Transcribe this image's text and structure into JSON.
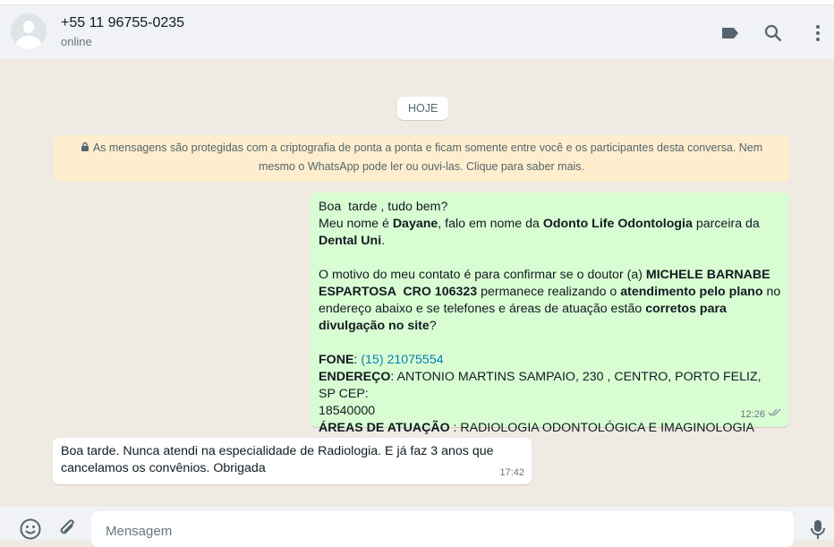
{
  "header": {
    "contact": "+55 11 96755-0235",
    "status": "online"
  },
  "chat": {
    "day_label": "HOJE",
    "encryption_notice": "As mensagens são protegidas com a criptografia de ponta a ponta e ficam somente entre você e os participantes desta conversa. Nem mesmo o WhatsApp pode ler ou ouvi-las. Clique para saber mais.",
    "messages": [
      {
        "direction": "out",
        "time": "12:26",
        "status": "read",
        "lines": [
          [
            {
              "t": "Boa  tarde , tudo bem?"
            }
          ],
          [
            {
              "t": "Meu nome é "
            },
            {
              "t": "Dayane",
              "b": true
            },
            {
              "t": ", falo em nome da "
            },
            {
              "t": "Odonto Life Odontologia",
              "b": true
            },
            {
              "t": " parceira da"
            }
          ],
          [
            {
              "t": "Dental Uni",
              "b": true
            },
            {
              "t": "."
            }
          ],
          [],
          [
            {
              "t": "O motivo do meu contato é para confirmar se o doutor (a) "
            },
            {
              "t": "MICHELE BARNABE",
              "b": true
            }
          ],
          [
            {
              "t": "ESPARTOSA  CRO 106323",
              "b": true
            },
            {
              "t": " permanece realizando o "
            },
            {
              "t": "atendimento pelo plano",
              "b": true
            },
            {
              "t": " no"
            }
          ],
          [
            {
              "t": "endereço abaixo e se telefones e áreas de atuação estão "
            },
            {
              "t": "corretos para",
              "b": true
            }
          ],
          [
            {
              "t": "divulgação no site",
              "b": true
            },
            {
              "t": "?"
            }
          ],
          [],
          [
            {
              "t": "FONE",
              "b": true
            },
            {
              "t": ": "
            },
            {
              "t": "(15) 21075554",
              "link": true
            }
          ],
          [
            {
              "t": "ENDEREÇO",
              "b": true
            },
            {
              "t": ": ANTONIO MARTINS SAMPAIO, 230 , CENTRO, PORTO FELIZ, SP CEP:"
            }
          ],
          [
            {
              "t": "18540000"
            }
          ],
          [
            {
              "t": "ÁREAS DE ATUAÇÃO",
              "b": true
            },
            {
              "t": " : RADIOLOGIA ODONTOLÓGICA E IMAGINOLOGIA"
            }
          ]
        ]
      },
      {
        "direction": "in",
        "time": "17:42",
        "lines": [
          [
            {
              "t": "Boa tarde. Nunca atendi na especialidade de Radiologia. E já faz 3 anos que"
            }
          ],
          [
            {
              "t": "cancelamos os convênios. Obrigada"
            }
          ]
        ]
      }
    ]
  },
  "composer": {
    "placeholder": "Mensagem"
  },
  "colors": {
    "outgoing": "#d9fdd3",
    "notice": "#ffeecd",
    "link": "#027eb5",
    "icon": "#54656f"
  }
}
